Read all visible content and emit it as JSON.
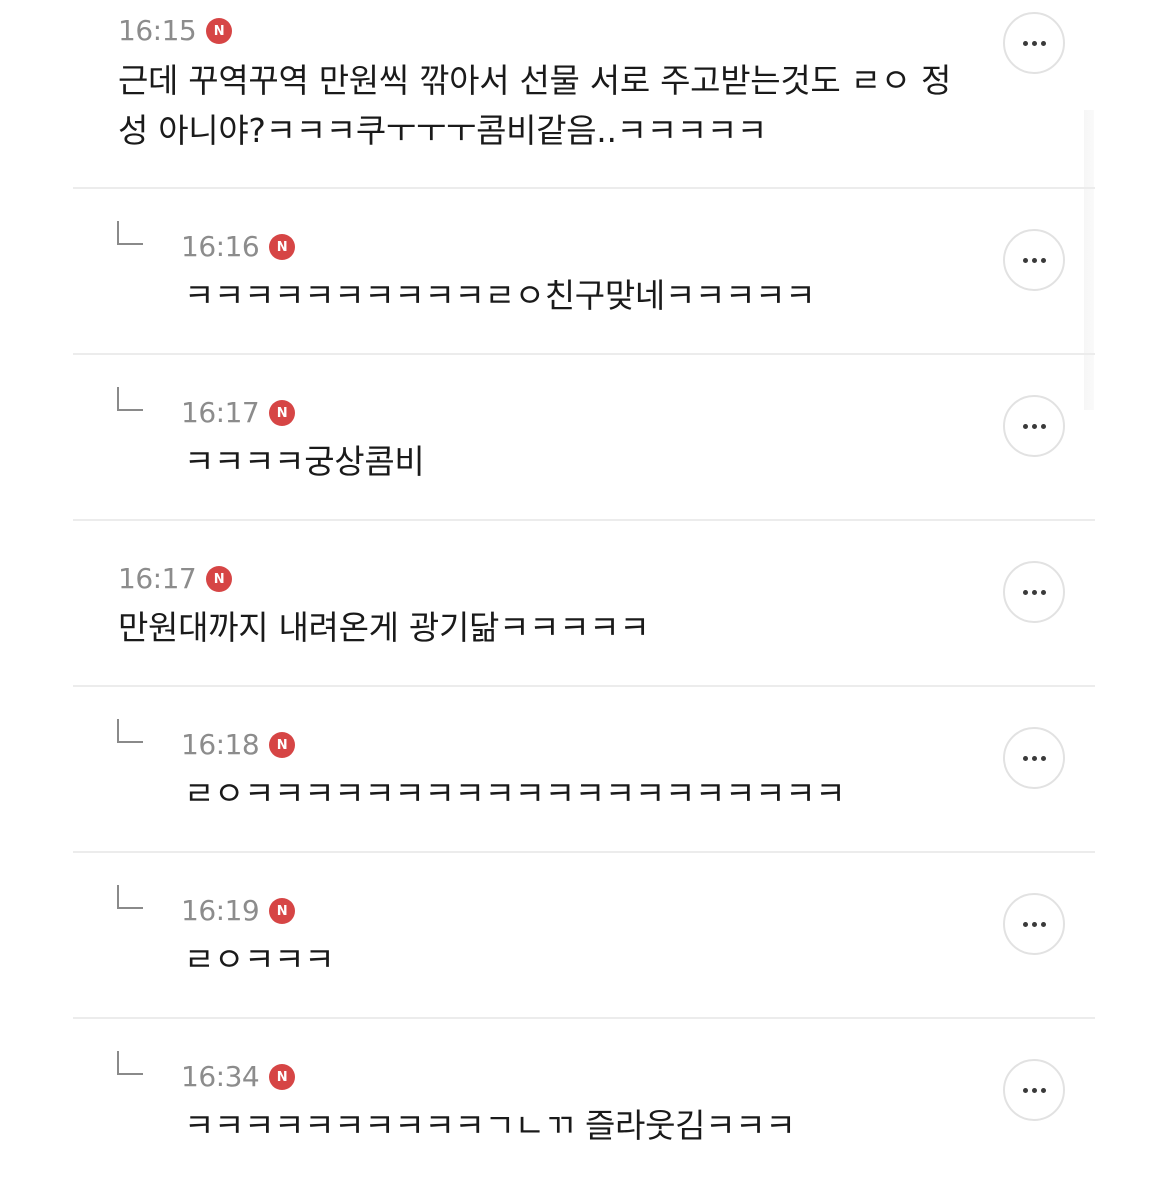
{
  "comments": [
    {
      "time": "16:15",
      "badge": "N",
      "is_reply": false,
      "line1": "근데 꾸역꾸역 만원씩 깎아서 선물 서로 주고받는것도 ㄹㅇ 정",
      "line2": "성 아니야?ㅋㅋㅋ쿠ㅜㅜㅜ콤비같음..ㅋㅋㅋㅋㅋ"
    },
    {
      "time": "16:16",
      "badge": "N",
      "is_reply": true,
      "line1": "ㅋㅋㅋㅋㅋㅋㅋㅋㅋㅋㄹㅇ친구맞네ㅋㅋㅋㅋㅋ"
    },
    {
      "time": "16:17",
      "badge": "N",
      "is_reply": true,
      "line1": "ㅋㅋㅋㅋ궁상콤비"
    },
    {
      "time": "16:17",
      "badge": "N",
      "is_reply": false,
      "line1": "만원대까지 내려온게 광기닮ㅋㅋㅋㅋㅋ"
    },
    {
      "time": "16:18",
      "badge": "N",
      "is_reply": true,
      "line1": "ㄹㅇㅋㅋㅋㅋㅋㅋㅋㅋㅋㅋㅋㅋㅋㅋㅋㅋㅋㅋㅋㅋ"
    },
    {
      "time": "16:19",
      "badge": "N",
      "is_reply": true,
      "line1": "ㄹㅇㅋㅋㅋ"
    },
    {
      "time": "16:34",
      "badge": "N",
      "is_reply": true,
      "line1": "ㅋㅋㅋㅋㅋㅋㅋㅋㅋㅋㄱㄴㄲ 즐라웃김ㅋㅋㅋ"
    }
  ],
  "colors": {
    "badge": "#d64545",
    "time": "#8c8c8c",
    "text": "#1a1a1a",
    "divider": "#ececec"
  },
  "icons": {
    "badge": "new-badge-icon",
    "more": "more-options-icon",
    "reply": "reply-arrow-icon"
  }
}
